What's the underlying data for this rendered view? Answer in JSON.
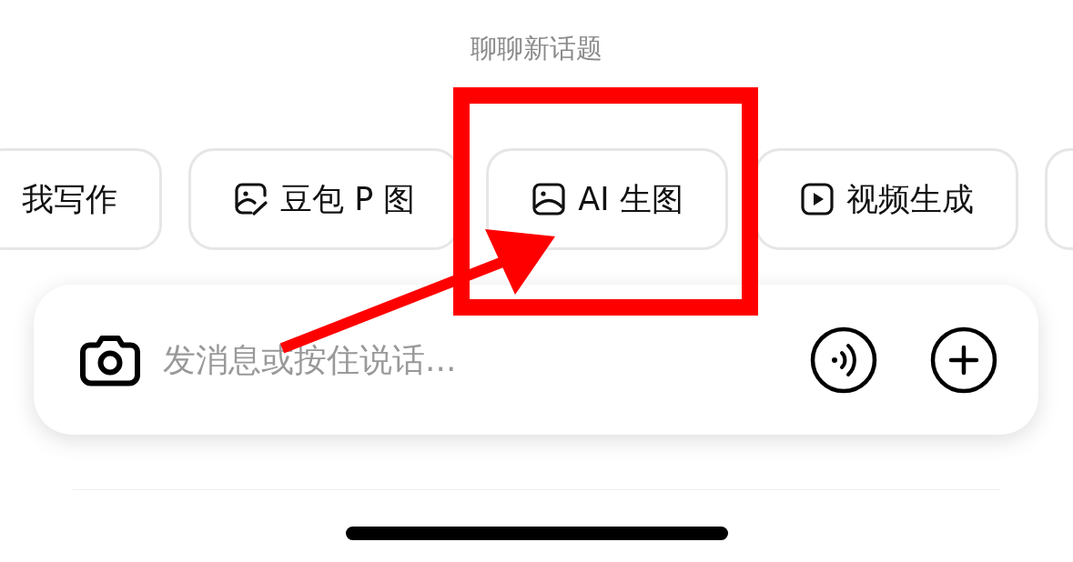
{
  "heading": "聊聊新话题",
  "chips": [
    {
      "kind": "text",
      "label": "我写作"
    },
    {
      "kind": "edit",
      "label": "豆包 P 图"
    },
    {
      "kind": "image",
      "label": "AI 生图"
    },
    {
      "kind": "video",
      "label": "视频生成"
    },
    {
      "kind": "blank"
    }
  ],
  "input": {
    "placeholder": "发消息或按住说话..."
  }
}
